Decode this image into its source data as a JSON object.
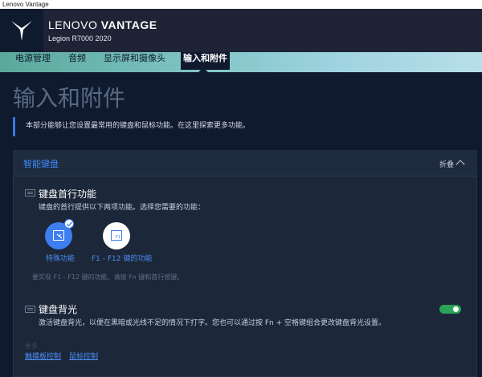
{
  "window": {
    "title": "Lenovo Vantage"
  },
  "header": {
    "brand_light": "LENOVO ",
    "brand_bold": "VANTAGE",
    "model": "Legion R7000 2020"
  },
  "tabs": [
    {
      "label": "电源管理"
    },
    {
      "label": "音频"
    },
    {
      "label": "显示屏和摄像头"
    },
    {
      "label": "输入和附件",
      "active": true
    }
  ],
  "page": {
    "title": "输入和附件",
    "description": "本部分能够让您设置最常用的键盘和鼠标功能。在这里探索更多功能。"
  },
  "card": {
    "title": "智能键盘",
    "collapse_label": "折叠"
  },
  "hotkey": {
    "title": "键盘首行功能",
    "subtitle": "键盘的首行提供以下两项功能。选择您需要的功能：",
    "options": [
      {
        "label": "特殊功能",
        "selected": true
      },
      {
        "label": "F1 - F12 键的功能",
        "icon_text": "F1",
        "selected": false
      }
    ],
    "hint": "要实现 F1 - F12 键的功能，请按 Fn 键和首行按键。"
  },
  "backlight": {
    "title": "键盘背光",
    "description": "激活键盘背光，以便在黑暗或光线不足的情况下打字。您也可以通过按 Fn + 空格键组合更改键盘背光设置。",
    "enabled": true
  },
  "related": {
    "label": "更多",
    "links": [
      "触摸板控制",
      "鼠标控制"
    ]
  },
  "colors": {
    "accent": "#3d7ef0",
    "toggle_on": "#2aa45a",
    "background": "#101a2f"
  }
}
